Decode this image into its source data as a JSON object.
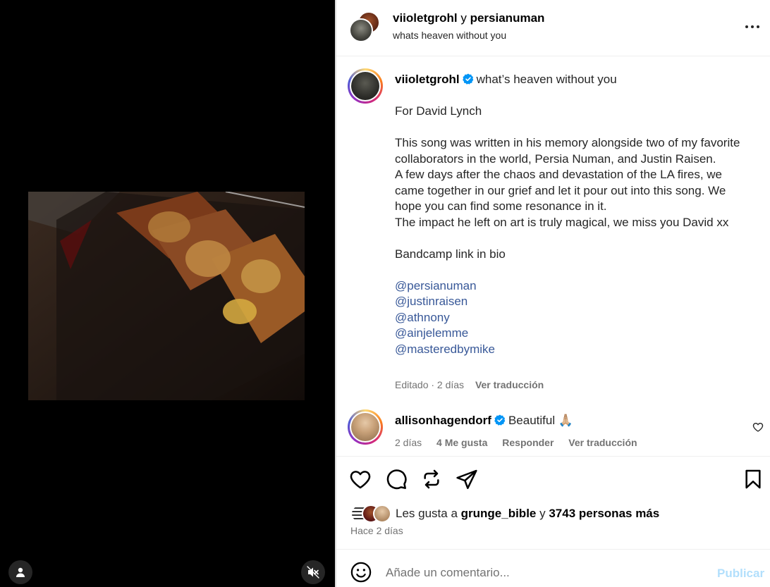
{
  "header": {
    "user1": "viioletgrohl",
    "conj": "y",
    "user2": "persianuman",
    "subtitle": "whats heaven without you"
  },
  "post": {
    "username": "viioletgrohl",
    "title": "what’s heaven without you",
    "paragraphs": [
      "For David Lynch",
      "This song was written in his memory alongside two of my favorite collaborators in the world, Persia Numan, and Justin Raisen.\nA few days after the chaos and devastation of the LA fires, we came together in our grief and let it pour out into this song. We hope you can find some resonance in it.\nThe impact he left on art is truly magical, we miss you David xx",
      "Bandcamp link in bio"
    ],
    "mentions": [
      "@persianuman",
      "@justinraisen",
      "@athnony",
      "@ainjelemme",
      "@masteredbymike"
    ],
    "meta": "Editado · 2 días",
    "translate": "Ver traducción"
  },
  "comment": {
    "username": "allisonhagendorf",
    "text": "Beautiful",
    "emoji": "🙏🏼",
    "time": "2 días",
    "likes": "4 Me gusta",
    "reply": "Responder",
    "translate": "Ver traducción"
  },
  "likes": {
    "prefix": "Les gusta a",
    "user": "grunge_bible",
    "conj": "y",
    "count": "3743 personas más"
  },
  "time_ago": "Hace 2 días",
  "composer": {
    "placeholder": "Añade un comentario...",
    "publish": "Publicar"
  },
  "colors": {
    "link": "#385898",
    "verified": "#0095f6",
    "publish_disabled": "#b2dffc"
  },
  "icons": [
    "more-icon",
    "verified-icon",
    "heart-icon",
    "comment-icon",
    "repost-icon",
    "share-icon",
    "bookmark-icon",
    "emoji-icon",
    "user-icon",
    "mute-icon"
  ]
}
